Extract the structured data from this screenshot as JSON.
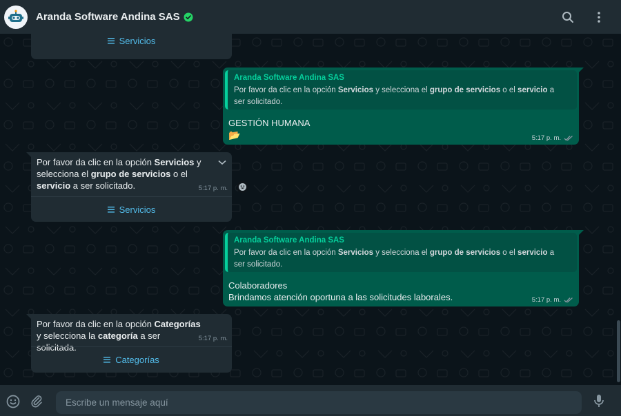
{
  "header": {
    "title": "Aranda Software Andina SAS",
    "verified_icon": "verified-check-icon",
    "avatar_icon": "robot-avatar-icon",
    "icons": [
      "search-icon",
      "kebab-menu-icon"
    ]
  },
  "messages": [
    {
      "direction": "in",
      "button_label": "Servicios"
    },
    {
      "direction": "out",
      "quote_author": "Aranda Software Andina SAS",
      "quote_parts": [
        "Por favor da clic en la opción ",
        "Servicios",
        " y selecciona el ",
        "grupo de servicios",
        " o el ",
        "servicio",
        " a ser solicitado."
      ],
      "line1": "GESTIÓN HUMANA",
      "emoji": "📂",
      "time": "5:17 p. m."
    },
    {
      "direction": "in",
      "text_parts": [
        "Por favor da clic en la opción ",
        "Servicios",
        " y selecciona el ",
        "grupo de servicios",
        " o el ",
        "servicio",
        " a ser solicitado."
      ],
      "time": "5:17 p. m.",
      "button_label": "Servicios"
    },
    {
      "direction": "out",
      "quote_author": "Aranda Software Andina SAS",
      "quote_parts": [
        "Por favor da clic en la opción ",
        "Servicios",
        " y selecciona el ",
        "grupo de servicios",
        " o el ",
        "servicio",
        " a ser solicitado."
      ],
      "line1": "Colaboradores",
      "line2": "Brindamos atención oportuna a las solicitudes laborales.",
      "time": "5:17 p. m."
    },
    {
      "direction": "in",
      "text_parts": [
        "Por favor da clic en la opción ",
        "Categorías",
        " y selecciona la ",
        "categoría",
        " a ser solicitada."
      ],
      "time": "5:17 p. m.",
      "button_label": "Categorías"
    }
  ],
  "composer": {
    "placeholder": "Escribe un mensaje aquí",
    "icons": [
      "emoji-icon",
      "attach-icon",
      "microphone-icon"
    ]
  },
  "colors": {
    "background": "#0b141a",
    "header": "#202c33",
    "incoming": "#202c33",
    "outgoing": "#005c4b",
    "link": "#53bdeb",
    "quote_accent": "#06cf9c"
  }
}
